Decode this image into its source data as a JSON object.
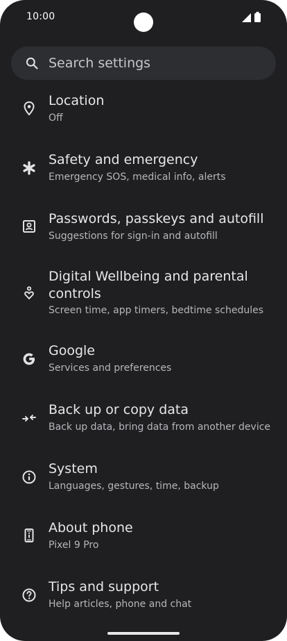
{
  "status": {
    "time": "10:00"
  },
  "search": {
    "placeholder": "Search settings"
  },
  "items": [
    {
      "title": "Location",
      "subtitle": "Off",
      "icon": "location-pin-icon"
    },
    {
      "title": "Safety and emergency",
      "subtitle": "Emergency SOS, medical info, alerts",
      "icon": "asterisk-icon"
    },
    {
      "title": "Passwords, passkeys and autofill",
      "subtitle": "Suggestions for sign-in and autofill",
      "icon": "passwords-icon"
    },
    {
      "title": "Digital Wellbeing and parental controls",
      "subtitle": "Screen time, app timers, bedtime schedules",
      "icon": "wellbeing-icon"
    },
    {
      "title": "Google",
      "subtitle": "Services and preferences",
      "icon": "google-g-icon"
    },
    {
      "title": "Back up or copy data",
      "subtitle": "Back up data, bring data from another device",
      "icon": "backup-arrows-icon"
    },
    {
      "title": "System",
      "subtitle": "Languages, gestures, time, backup",
      "icon": "info-icon"
    },
    {
      "title": "About phone",
      "subtitle": "Pixel 9 Pro",
      "icon": "phone-info-icon"
    },
    {
      "title": "Tips and support",
      "subtitle": "Help articles, phone and chat",
      "icon": "help-question-icon"
    }
  ]
}
